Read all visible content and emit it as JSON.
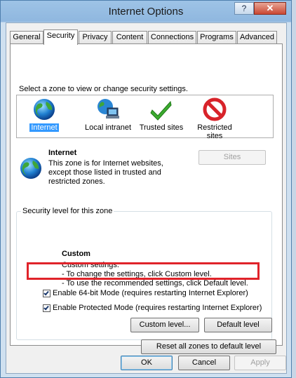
{
  "window": {
    "title": "Internet Options",
    "help_label": "?",
    "close_label": "✕"
  },
  "tabs": [
    {
      "label": "General"
    },
    {
      "label": "Security"
    },
    {
      "label": "Privacy"
    },
    {
      "label": "Content"
    },
    {
      "label": "Connections"
    },
    {
      "label": "Programs"
    },
    {
      "label": "Advanced"
    }
  ],
  "security": {
    "zone_prompt": "Select a zone to view or change security settings.",
    "zones": [
      {
        "label": "Internet",
        "icon": "globe-icon",
        "selected": true
      },
      {
        "label": "Local intranet",
        "icon": "intranet-icon"
      },
      {
        "label": "Trusted sites",
        "icon": "checkmark-icon"
      },
      {
        "label": "Restricted sites",
        "icon": "restricted-icon"
      }
    ],
    "zone_info": {
      "title": "Internet",
      "description": "This zone is for Internet websites, except those listed in trusted and restricted zones.",
      "sites_button": "Sites"
    },
    "level_group": {
      "legend": "Security level for this zone",
      "level_name": "Custom",
      "level_desc": "Custom settings.",
      "level_bullets": [
        "- To change the settings, click Custom level.",
        "- To use the recommended settings, click Default level."
      ],
      "checkboxes": [
        {
          "label": "Enable 64-bit Mode (requires restarting Internet Explorer)",
          "checked": true
        },
        {
          "label": "Enable Protected Mode (requires restarting Internet Explorer)",
          "checked": true
        }
      ],
      "custom_level_button": "Custom level...",
      "default_level_button": "Default level"
    },
    "reset_button": "Reset all zones to default level"
  },
  "footer": {
    "ok": "OK",
    "cancel": "Cancel",
    "apply": "Apply"
  },
  "colors": {
    "highlight": "#e0232a",
    "selection": "#3399ff"
  }
}
